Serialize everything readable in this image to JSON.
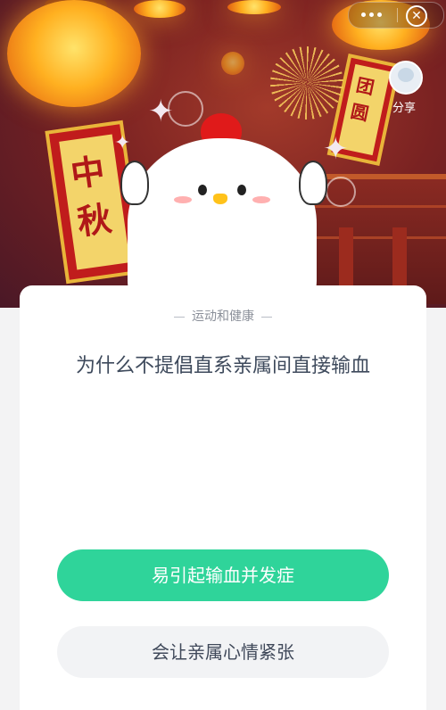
{
  "header": {
    "banner_left_chars": [
      "中",
      "秋"
    ],
    "banner_right_chars": [
      "团",
      "圆"
    ],
    "share_label": "分享",
    "icons": [
      "more-icon",
      "close-icon",
      "share-icon"
    ]
  },
  "quiz": {
    "category": "运动和健康",
    "question": "为什么不提倡直系亲属间直接输血",
    "options": [
      {
        "label": "易引起输血并发症",
        "style": "primary",
        "color": "#2fd49a"
      },
      {
        "label": "会让亲属心情紧张",
        "style": "secondary",
        "color": "#f2f3f5"
      }
    ]
  }
}
